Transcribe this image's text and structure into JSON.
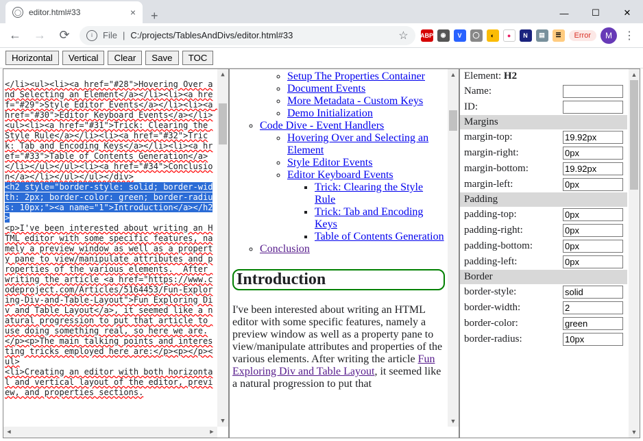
{
  "browser": {
    "tab_title": "editor.html#33",
    "url_prefix": "File",
    "url_path": "C:/projects/TablesAndDivs/editor.html#33",
    "error_badge": "Error",
    "avatar_letter": "M"
  },
  "toolbar": {
    "horizontal": "Horizontal",
    "vertical": "Vertical",
    "clear": "Clear",
    "save": "Save",
    "toc": "TOC"
  },
  "code": {
    "pre1": "</li><ul><li><a href=\"#28\">Hovering Over and Selecting an Element</a></li><li><a href=\"#29\">Style Editor Events</a></li><li><a href=\"#30\">Editor Keyboard Events</a></li><ul><li><a href=\"#31\">Trick: Clearing the Style Rule</a></li><li><a href=\"#32\">Trick: Tab and Encoding Keys</a></li><li><a href=\"#33\">Table of Contents Generation</a></li></ul></ul><li><a href=\"#34\">Conclusion</a></li></ul></ul></div>",
    "sel": "<h2 style=\"border-style: solid; border-width: 2px; border-color: green; border-radius: 10px;\"><a name=\"1\">Introduction</a></h2>",
    "post1": "<p>I've been interested about writing an HTML editor with some specific features, namely a preview window as well as a property pane to view/manipulate attributes and properties of the various elements.  After writing the article <a href=\"https://www.codeproject.com/Articles/5164453/Fun-Exploring-Div-and-Table-Layout\">Fun Exploring Div and Table Layout</a>, it seemed like a natural progression to put that article to use doing something real, so here we are.</p><p>The main talking points and interesting tricks employed here are:</p><p></p><ul>\n<li>Creating an editor with both horizontal and vertical layout of the editor, preview, and properties sections."
  },
  "preview": {
    "toc": {
      "setup_properties": "Setup The Properties Container",
      "document_events": "Document Events",
      "more_metadata": "More Metadata - Custom Keys",
      "demo_init": "Demo Initialization",
      "code_dive": "Code Dive - Event Handlers",
      "hovering": "Hovering Over and Selecting an Element",
      "style_editor": "Style Editor Events",
      "editor_keyboard": "Editor Keyboard Events",
      "trick_clear": "Trick: Clearing the Style Rule",
      "trick_tab": "Trick: Tab and Encoding Keys",
      "toc_gen": "Table of Contents Generation",
      "conclusion": "Conclusion"
    },
    "intro_heading": "Introduction",
    "intro_text": "I've been interested about writing an HTML editor with some specific features, namely a preview window as well as a property pane to view/manipulate attributes and properties of the various elements. After writing the article ",
    "intro_link": "Fun Exploring Div and Table Layout",
    "intro_text2": ", it seemed like a natural progression to put that"
  },
  "props": {
    "element_label": "Element: ",
    "element_value": "H2",
    "name_label": "Name:",
    "name_value": "",
    "id_label": "ID:",
    "id_value": "",
    "section_margins": "Margins",
    "margin_top_label": "margin-top:",
    "margin_top_value": "19.92px",
    "margin_right_label": "margin-right:",
    "margin_right_value": "0px",
    "margin_bottom_label": "margin-bottom:",
    "margin_bottom_value": "19.92px",
    "margin_left_label": "margin-left:",
    "margin_left_value": "0px",
    "section_padding": "Padding",
    "padding_top_label": "padding-top:",
    "padding_top_value": "0px",
    "padding_right_label": "padding-right:",
    "padding_right_value": "0px",
    "padding_bottom_label": "padding-bottom:",
    "padding_bottom_value": "0px",
    "padding_left_label": "padding-left:",
    "padding_left_value": "0px",
    "section_border": "Border",
    "border_style_label": "border-style:",
    "border_style_value": "solid",
    "border_width_label": "border-width:",
    "border_width_value": "2",
    "border_color_label": "border-color:",
    "border_color_value": "green",
    "border_radius_label": "border-radius:",
    "border_radius_value": "10px"
  }
}
